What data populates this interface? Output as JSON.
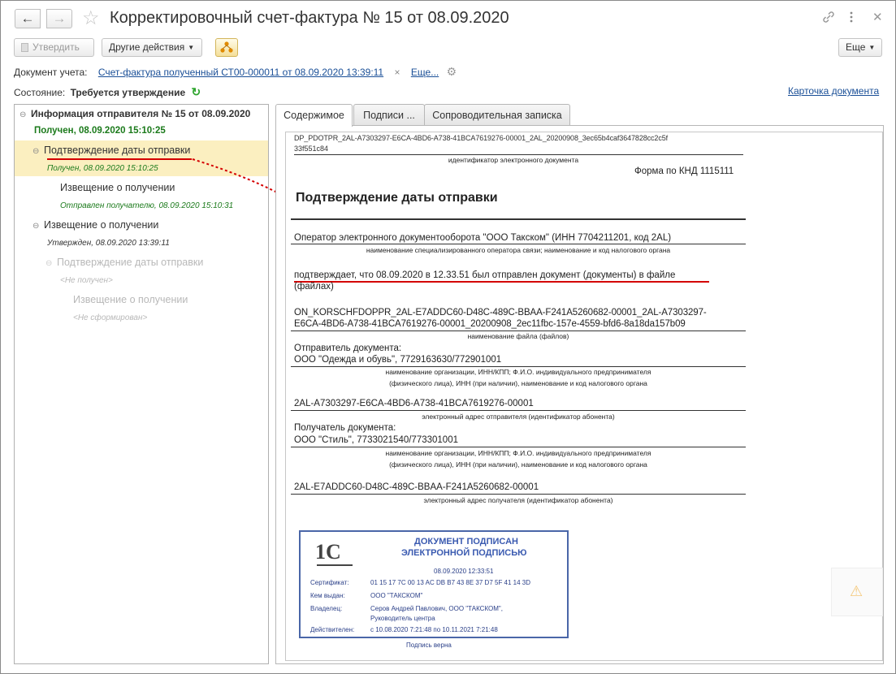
{
  "window": {
    "title": "Корректировочный счет-фактура № 15 от 08.09.2020"
  },
  "nav": {
    "back": "←",
    "forward": "→"
  },
  "toolbar": {
    "approve": "Утвердить",
    "other_actions": "Другие действия",
    "more": "Еще"
  },
  "account_doc": {
    "label": "Документ учета:",
    "value": "Счет-фактура полученный СТ00-000011 от 08.09.2020 13:39:11",
    "clear": "×",
    "more_link": "Еще..."
  },
  "status": {
    "label": "Состояние:",
    "value": "Требуется утверждение"
  },
  "doc_card_link": "Карточка документа",
  "tree": [
    {
      "label": "Информация отправителя № 15 от 08.09.2020",
      "sub": "Получен, 08.09.2020 15:10:25"
    },
    {
      "label": "Подтверждение даты отправки",
      "sub": "Получен, 08.09.2020 15:10:25"
    },
    {
      "label": "Извещение о получении",
      "sub": "Отправлен получателю, 08.09.2020 15:10:31"
    },
    {
      "label": "Извещение о получении",
      "sub": "Утвержден, 08.09.2020 13:39:11"
    },
    {
      "label": "Подтверждение даты отправки",
      "sub": "<Не получен>"
    },
    {
      "label": "Извещение о получении",
      "sub": "<Не сформирован>"
    }
  ],
  "tabs": [
    "Содержимое",
    "Подписи ...",
    "Сопроводительная записка"
  ],
  "document": {
    "file_id_line1": "DP_PDOTPR_2AL-A7303297-E6CA-4BD6-A738-41BCA7619276-00001_2AL_20200908_3ec65b4caf3647828cc2c5f",
    "file_id_line2": "33f551c84",
    "file_id_caption": "идентификатор электронного документа",
    "form": "Форма по КНД 1115111",
    "heading": "Подтверждение даты отправки",
    "operator": "Оператор электронного документооборота \"ООО Такском\" (ИНН 7704211201, код 2AL)",
    "operator_caption": "наименование специализированного оператора связи; наименование и код налогового органа",
    "confirm_line1": "подтверждает, что 08.09.2020 в 12.33.51 был отправлен документ  (документы) в файле",
    "confirm_line2": "(файлах)",
    "filename_line1": "ON_KORSCHFDOPPR_2AL-E7ADDC60-D48C-489C-BBAA-F241A5260682-00001_2AL-A7303297-",
    "filename_line2": "E6CA-4BD6-A738-41BCA7619276-00001_20200908_2ec11fbc-157e-4559-bfd6-8a18da157b09",
    "filename_caption": "наименование файла (файлов)",
    "sender_label": "Отправитель документа:",
    "sender_value": "ООО \"Одежда и обувь\", 7729163630/772901001",
    "org_caption1": "наименование организации, ИНН/КПП; Ф.И.О. индивидуального предпринимателя",
    "org_caption2": "(физического лица), ИНН (при наличии), наименование и код налогового органа",
    "sender_addr": "2AL-A7303297-E6CA-4BD6-A738-41BCA7619276-00001",
    "sender_addr_caption": "электронный адрес отправителя (идентификатор абонента)",
    "recipient_label": "Получатель документа:",
    "recipient_value": "ООО \"Стиль\", 7733021540/773301001",
    "recipient_addr": "2AL-E7ADDC60-D48C-489C-BBAA-F241A5260682-00001",
    "recipient_addr_caption": "электронный адрес получателя (идентификатор абонента)"
  },
  "stamp": {
    "logo": "1С",
    "title1": "ДОКУМЕНТ ПОДПИСАН",
    "title2": "ЭЛЕКТРОННОЙ ПОДПИСЬЮ",
    "date": "08.09.2020 12:33:51",
    "cert_label": "Сертификат:",
    "cert_value": "01 15 17 7C 00 13 AC DB B7 43 8E 37 D7 5F 41 14 3D",
    "issuer_label": "Кем выдан:",
    "issuer_value": "ООО \"ТАКСКОМ\"",
    "owner_label": "Владелец:",
    "owner_value1": "Серов Андрей Павлович, ООО \"ТАКСКОМ\",",
    "owner_value2": "Руководитель центра",
    "valid_label": "Действителен:",
    "valid_value": "с 10.08.2020 7:21:48 по 10.11.2021 7:21:48",
    "verified": "Подпись верна"
  },
  "colors": {
    "accent_red": "#d40000",
    "link": "#1a4f97",
    "green_text": "#1b7a1b",
    "highlight": "#fbefc0",
    "stamp_border": "#4a66a8"
  }
}
